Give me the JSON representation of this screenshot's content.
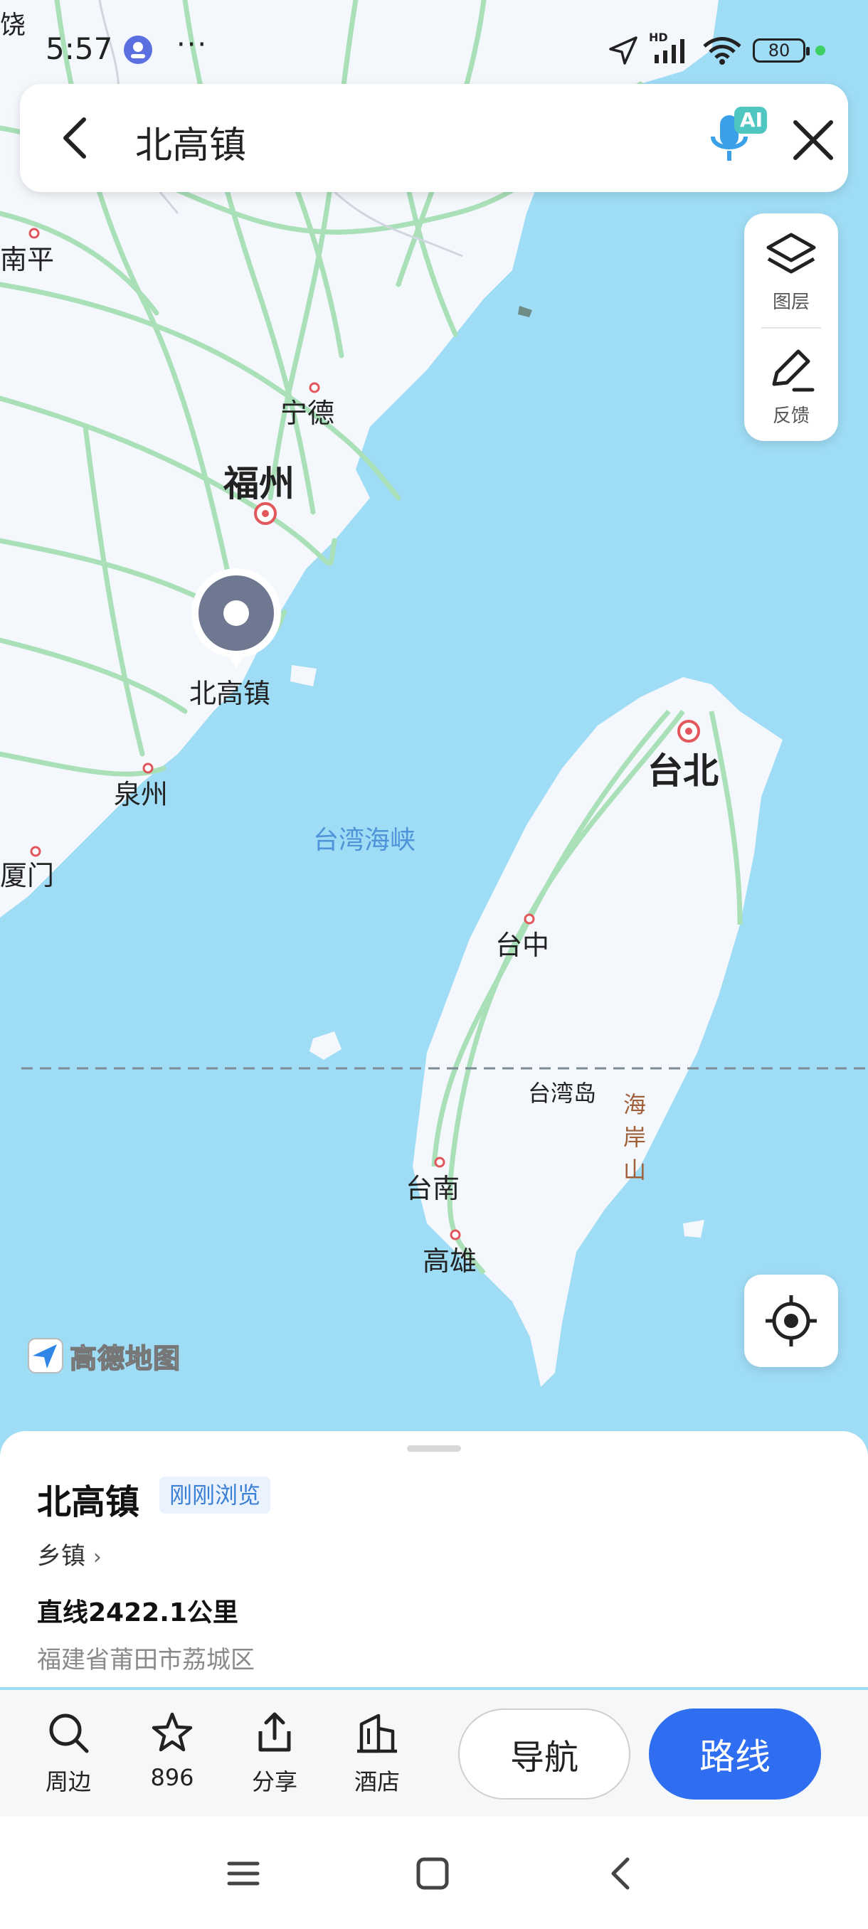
{
  "status_bar": {
    "time": "5:57",
    "more": "···",
    "network": "HD",
    "battery": "80"
  },
  "search": {
    "query": "北高镇",
    "voice_badge": "AI"
  },
  "map": {
    "labels": {
      "nanping": "南平",
      "ningde": "宁德",
      "fuzhou": "福州",
      "beigaozhen": "北高镇",
      "quanzhou": "泉州",
      "xiamen": "厦门",
      "strait": "台湾海峡",
      "taipei": "台北",
      "taichung": "台中",
      "taiwan_island": "台湾岛",
      "coastal_range": "海岸山",
      "tainan": "台南",
      "kaohsiung": "高雄",
      "corner": "饶"
    },
    "logo": "高德地图"
  },
  "tools": {
    "layers": "图层",
    "feedback": "反馈"
  },
  "place": {
    "name": "北高镇",
    "tag": "刚刚浏览",
    "category": "乡镇",
    "distance": "直线2422.1公里",
    "address": "福建省莆田市荔城区"
  },
  "actions": {
    "nearby": "周边",
    "favorites": "896",
    "share": "分享",
    "hotel": "酒店",
    "navigate": "导航",
    "route": "路线"
  },
  "colors": {
    "sea": "#9fdcf5",
    "land": "#f4f7fc",
    "road": "#a9e0b8",
    "accent": "#2f6ef0",
    "pin": "#6f7891"
  }
}
